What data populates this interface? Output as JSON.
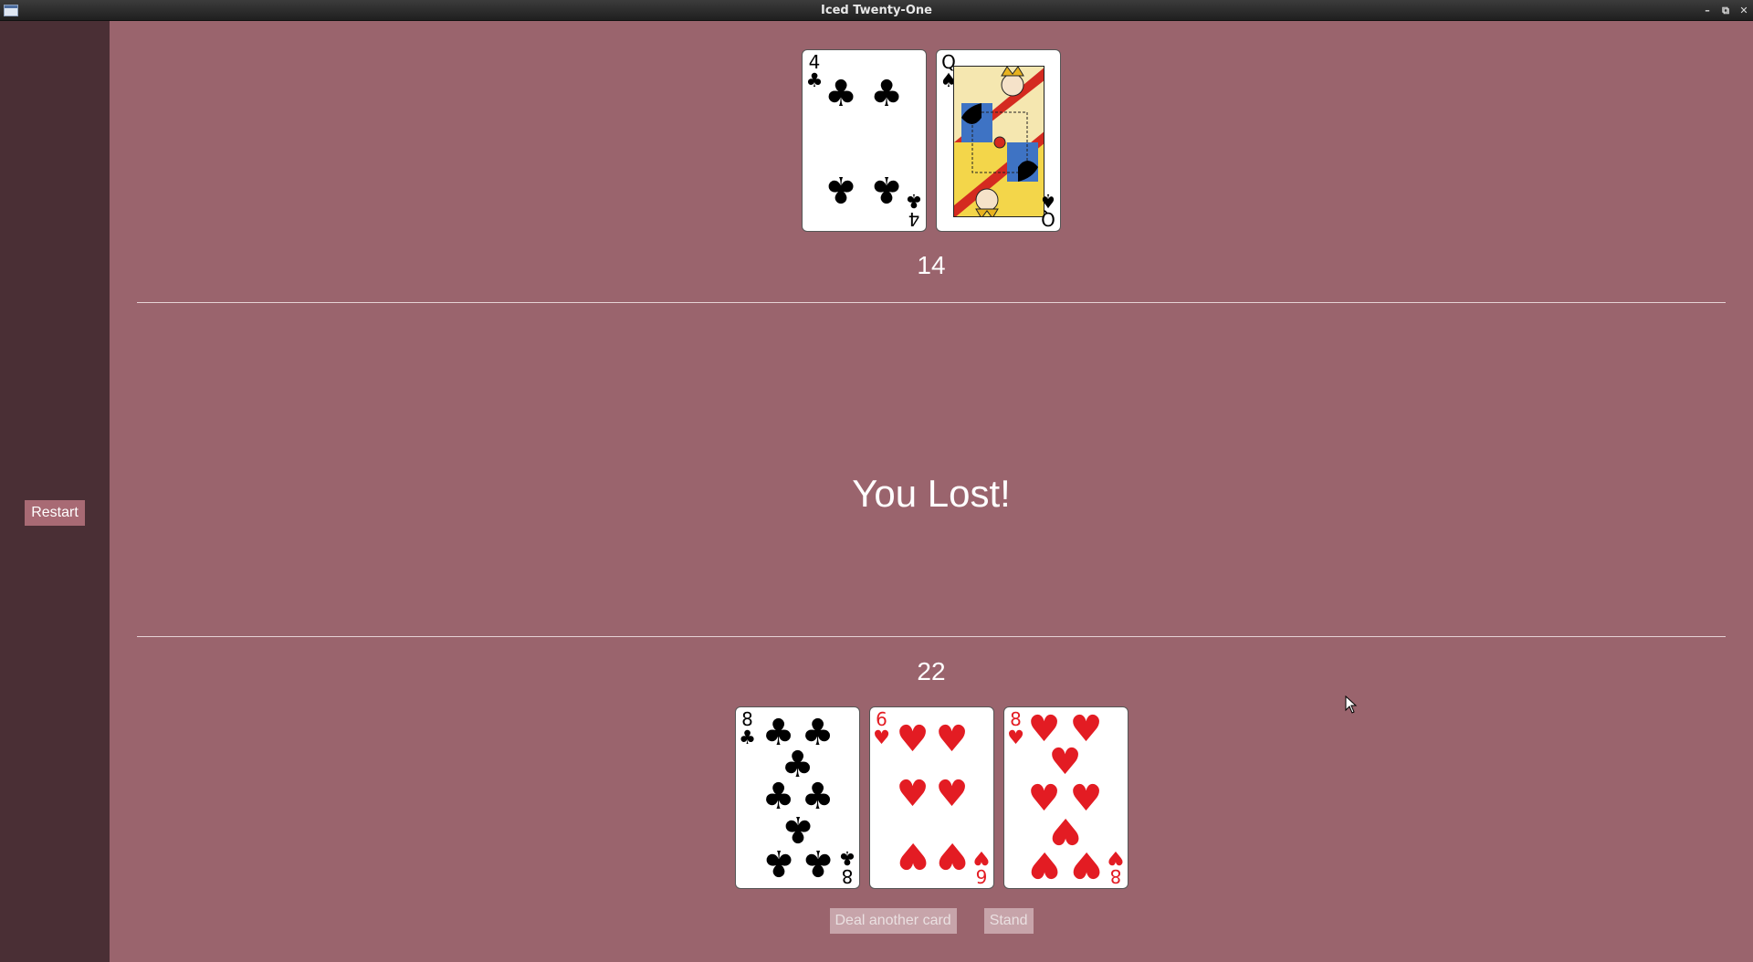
{
  "window": {
    "title": "Iced Twenty-One"
  },
  "sidebar": {
    "restart_label": "Restart"
  },
  "dealer": {
    "score": "14",
    "cards": [
      {
        "rank": "4",
        "suit": "clubs",
        "suit_symbol": "♣",
        "color": "black"
      },
      {
        "rank": "Q",
        "suit": "spades",
        "suit_symbol": "♠",
        "color": "black"
      }
    ]
  },
  "result": "You Lost!",
  "player": {
    "score": "22",
    "cards": [
      {
        "rank": "8",
        "suit": "clubs",
        "suit_symbol": "♣",
        "color": "black"
      },
      {
        "rank": "6",
        "suit": "hearts",
        "suit_symbol": "♥",
        "color": "red"
      },
      {
        "rank": "8",
        "suit": "hearts",
        "suit_symbol": "♥",
        "color": "red"
      }
    ]
  },
  "actions": {
    "deal_label": "Deal another card",
    "stand_label": "Stand"
  },
  "colors": {
    "table": "#9a646d",
    "sidebar": "#4a2f35",
    "button": "#a86a74",
    "red_suit": "#e31c23"
  }
}
